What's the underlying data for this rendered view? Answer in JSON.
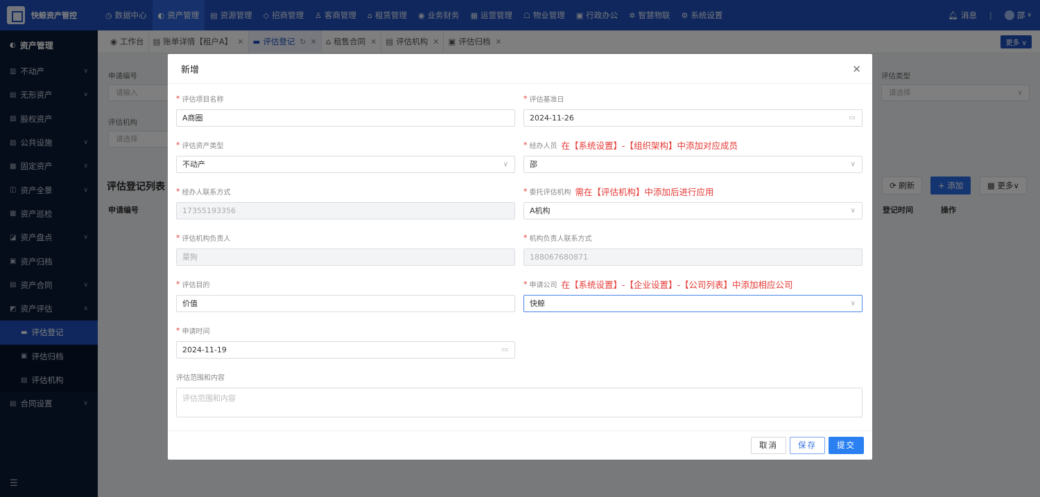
{
  "app": {
    "name": "快鲸资产管控"
  },
  "topnav": [
    {
      "label": "数据中心",
      "icon": "◷"
    },
    {
      "label": "资产管理",
      "icon": "◐"
    },
    {
      "label": "资源管理",
      "icon": "▤"
    },
    {
      "label": "招商管理",
      "icon": "◇"
    },
    {
      "label": "客商管理",
      "icon": "♙"
    },
    {
      "label": "租赁管理",
      "icon": "⌂"
    },
    {
      "label": "业务财务",
      "icon": "◉"
    },
    {
      "label": "运营管理",
      "icon": "▦"
    },
    {
      "label": "物业管理",
      "icon": "☖"
    },
    {
      "label": "行政办公",
      "icon": "▣"
    },
    {
      "label": "智慧物联",
      "icon": "✲"
    },
    {
      "label": "系统设置",
      "icon": "⚙"
    }
  ],
  "top_right": {
    "messages": "消息",
    "user": "邵"
  },
  "sidebar": {
    "title": "资产管理",
    "items": [
      {
        "label": "不动产",
        "icon": "▥"
      },
      {
        "label": "无形资产",
        "icon": "▤"
      },
      {
        "label": "股权资产",
        "icon": "▧"
      },
      {
        "label": "公共设施",
        "icon": "▨"
      },
      {
        "label": "固定资产",
        "icon": "▩"
      },
      {
        "label": "资产全景",
        "icon": "◫"
      },
      {
        "label": "资产巡检",
        "icon": "▦"
      },
      {
        "label": "资产盘点",
        "icon": "◪"
      },
      {
        "label": "资产归档",
        "icon": "▣"
      },
      {
        "label": "资产合同",
        "icon": "▤"
      },
      {
        "label": "资产评估",
        "icon": "◩"
      }
    ],
    "sub_items": [
      {
        "label": "评估登记",
        "icon": "▬"
      },
      {
        "label": "评估归档",
        "icon": "▣"
      },
      {
        "label": "评估机构",
        "icon": "▤"
      }
    ],
    "last_item": {
      "label": "合同设置",
      "icon": "▤"
    }
  },
  "tabs": [
    {
      "label": "工作台",
      "icon": "◉",
      "closable": false
    },
    {
      "label": "账单详情【租户A】",
      "icon": "▤",
      "closable": true
    },
    {
      "label": "评估登记",
      "icon": "▬",
      "closable": true,
      "active": true
    },
    {
      "label": "租售合同",
      "icon": "⌂",
      "closable": true
    },
    {
      "label": "评估机构",
      "icon": "▤",
      "closable": true
    },
    {
      "label": "评估归档",
      "icon": "▣",
      "closable": true
    }
  ],
  "tab_more": "更多",
  "background": {
    "label_apply_no": "申请编号",
    "apply_no_placeholder": "请输入",
    "label_agency": "评估机构",
    "agency_placeholder": "请选择",
    "label_asset_type": "评估类型",
    "asset_type_placeholder": "请选择",
    "list_title": "评估登记列表",
    "th_apply_no": "申请编号",
    "th_time": "登记时间",
    "th_op": "操作",
    "btn_refresh": "刷新",
    "btn_add": "添加",
    "btn_more": "更多"
  },
  "modal": {
    "title": "新增",
    "fields": {
      "project_name": {
        "label": "评估项目名称",
        "value": "A商圈"
      },
      "base_date": {
        "label": "评估基准日",
        "value": "2024-11-26"
      },
      "asset_type": {
        "label": "评估资产类型",
        "value": "不动产"
      },
      "handler": {
        "label": "经办人员",
        "value": "邵",
        "note": "在【系统设置】-【组织架构】中添加对应成员"
      },
      "handler_phone": {
        "label": "经办人联系方式",
        "value": "17355193356"
      },
      "agency": {
        "label": "委托评估机构",
        "value": "A机构",
        "note": "需在【评估机构】中添加后进行应用"
      },
      "agency_head": {
        "label": "评估机构负责人",
        "value": "菜狗"
      },
      "agency_head_phone": {
        "label": "机构负责人联系方式",
        "value": "188067680871"
      },
      "purpose": {
        "label": "评估目的",
        "value": "价值"
      },
      "company": {
        "label": "申请公司",
        "value": "快鲸",
        "note": "在【系统设置】-【企业设置】-【公司列表】中添加相应公司"
      },
      "apply_time": {
        "label": "申请时间",
        "value": "2024-11-19"
      },
      "scope": {
        "label": "评估范围和内容",
        "placeholder": "评估范围和内容"
      }
    },
    "buttons": {
      "cancel": "取消",
      "save": "保存",
      "submit": "提交"
    }
  }
}
